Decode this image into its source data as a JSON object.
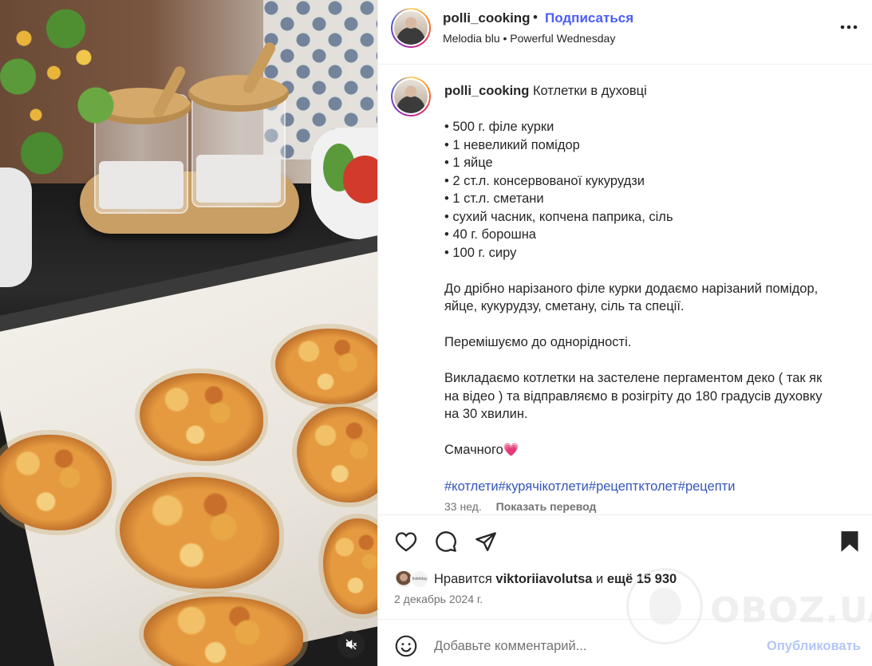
{
  "post": {
    "username": "polli_cooking",
    "separator": "•",
    "follow_label": "Подписаться",
    "audio": "Melodia blu • Powerful Wednesday"
  },
  "caption": {
    "username": "polli_cooking",
    "title": "Котлетки в духовці",
    "ingredients": [
      "• 500 г. філе курки",
      "• 1 невеликий помідор",
      "• 1 яйце",
      "• 2 ст.л. консервованої кукурудзи",
      "• 1 ст.л. сметани",
      "• сухий часник, копчена паприка, сіль",
      "• 40 г. борошна",
      "• 100 г. сиру"
    ],
    "step1_line1": "До дрібно нарізаного філе курки додаємо нарізаний помідор,",
    "step1_line2": "яйце, кукурудзу, сметану, сіль та спеції.",
    "step2": "Перемішуємо до однорідності.",
    "step3_line1": "Викладаємо котлетки на застелене пергаментом деко ( так як",
    "step3_line2": "на відео ) та відправляємо в розігріту до 180 градусів духовку",
    "step3_line3": "на 30 хвилин.",
    "closing": "Смачного",
    "closing_emoji": "💗",
    "hashtags": [
      "#котлети",
      "#курячікотлети",
      "#рецептктолет",
      "#рецепти"
    ],
    "age": "33 нед.",
    "translate_label": "Показать перевод"
  },
  "likes": {
    "prefix": "Нравится",
    "user": "viktoriiavolutsa",
    "middle": "и",
    "count_text": "ещё 15 930",
    "second_avatar_text": "Indolday"
  },
  "date": "2 декабрь 2024 г.",
  "comment": {
    "placeholder": "Добавьте комментарий...",
    "publish_label": "Опубликовать"
  },
  "watermark": {
    "text": "OBOZ.UA"
  },
  "icons": {
    "more": "more-horizontal-icon",
    "like": "heart-icon",
    "comment": "comment-bubble-icon",
    "share": "paper-plane-icon",
    "save": "bookmark-filled-icon",
    "emoji": "smiley-icon",
    "mute": "speaker-muted-icon"
  },
  "colors": {
    "link_blue": "#4a5df9",
    "hashtag_blue": "#3456b8",
    "muted_text": "#737373",
    "publish_disabled": "#b3c6f7",
    "heart_emoji": "#e23a6f"
  }
}
